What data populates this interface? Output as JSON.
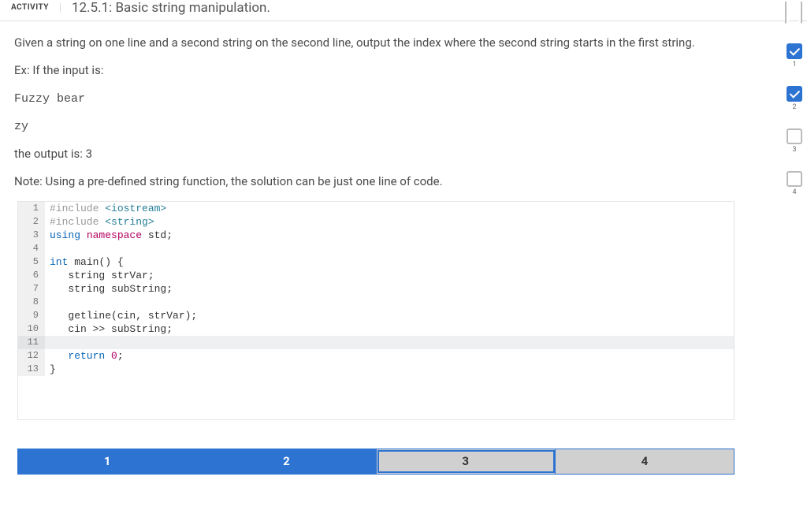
{
  "header": {
    "activity_label": "ACTIVITY",
    "title": "12.5.1: Basic string manipulation."
  },
  "prompt": {
    "intro": "Given a string on one line and a second string on the second line, output the index where the second string starts in the first string.",
    "ex_label": "Ex: If the input is:",
    "input_line1": "Fuzzy bear",
    "input_line2": "zy",
    "output_label": "the output is: ",
    "output_value": "3",
    "note": "Note: Using a pre-defined string function, the solution can be just one line of code."
  },
  "code": {
    "active_line": 11,
    "lines": [
      [
        {
          "t": "#include ",
          "c": "tok-pp"
        },
        {
          "t": "<iostream>",
          "c": "tok-ty"
        }
      ],
      [
        {
          "t": "#include ",
          "c": "tok-pp"
        },
        {
          "t": "<string>",
          "c": "tok-ty"
        }
      ],
      [
        {
          "t": "using ",
          "c": "tok-kw"
        },
        {
          "t": "namespace ",
          "c": "tok-ns"
        },
        {
          "t": "std;",
          "c": "tok-id"
        }
      ],
      [],
      [
        {
          "t": "int ",
          "c": "tok-kw"
        },
        {
          "t": "main",
          "c": "tok-id"
        },
        {
          "t": "() {",
          "c": "tok-id"
        }
      ],
      [
        {
          "t": "   string strVar;",
          "c": "tok-id"
        }
      ],
      [
        {
          "t": "   string subString;",
          "c": "tok-id"
        }
      ],
      [],
      [
        {
          "t": "   getline(cin, strVar);",
          "c": "tok-id"
        }
      ],
      [
        {
          "t": "   cin >> subString;",
          "c": "tok-id"
        }
      ],
      [],
      [
        {
          "t": "   ",
          "c": ""
        },
        {
          "t": "return ",
          "c": "tok-kw"
        },
        {
          "t": "0",
          "c": "tok-num"
        },
        {
          "t": ";",
          "c": "tok-id"
        }
      ],
      [
        {
          "t": "}",
          "c": "tok-id"
        }
      ]
    ]
  },
  "progress": {
    "items": [
      {
        "n": "1",
        "done": true
      },
      {
        "n": "2",
        "done": true
      },
      {
        "n": "3",
        "done": false
      },
      {
        "n": "4",
        "done": false
      }
    ]
  },
  "tabs": {
    "items": [
      {
        "label": "1",
        "state": "done"
      },
      {
        "label": "2",
        "state": "done"
      },
      {
        "label": "3",
        "state": "current"
      },
      {
        "label": "4",
        "state": "pending"
      }
    ]
  }
}
